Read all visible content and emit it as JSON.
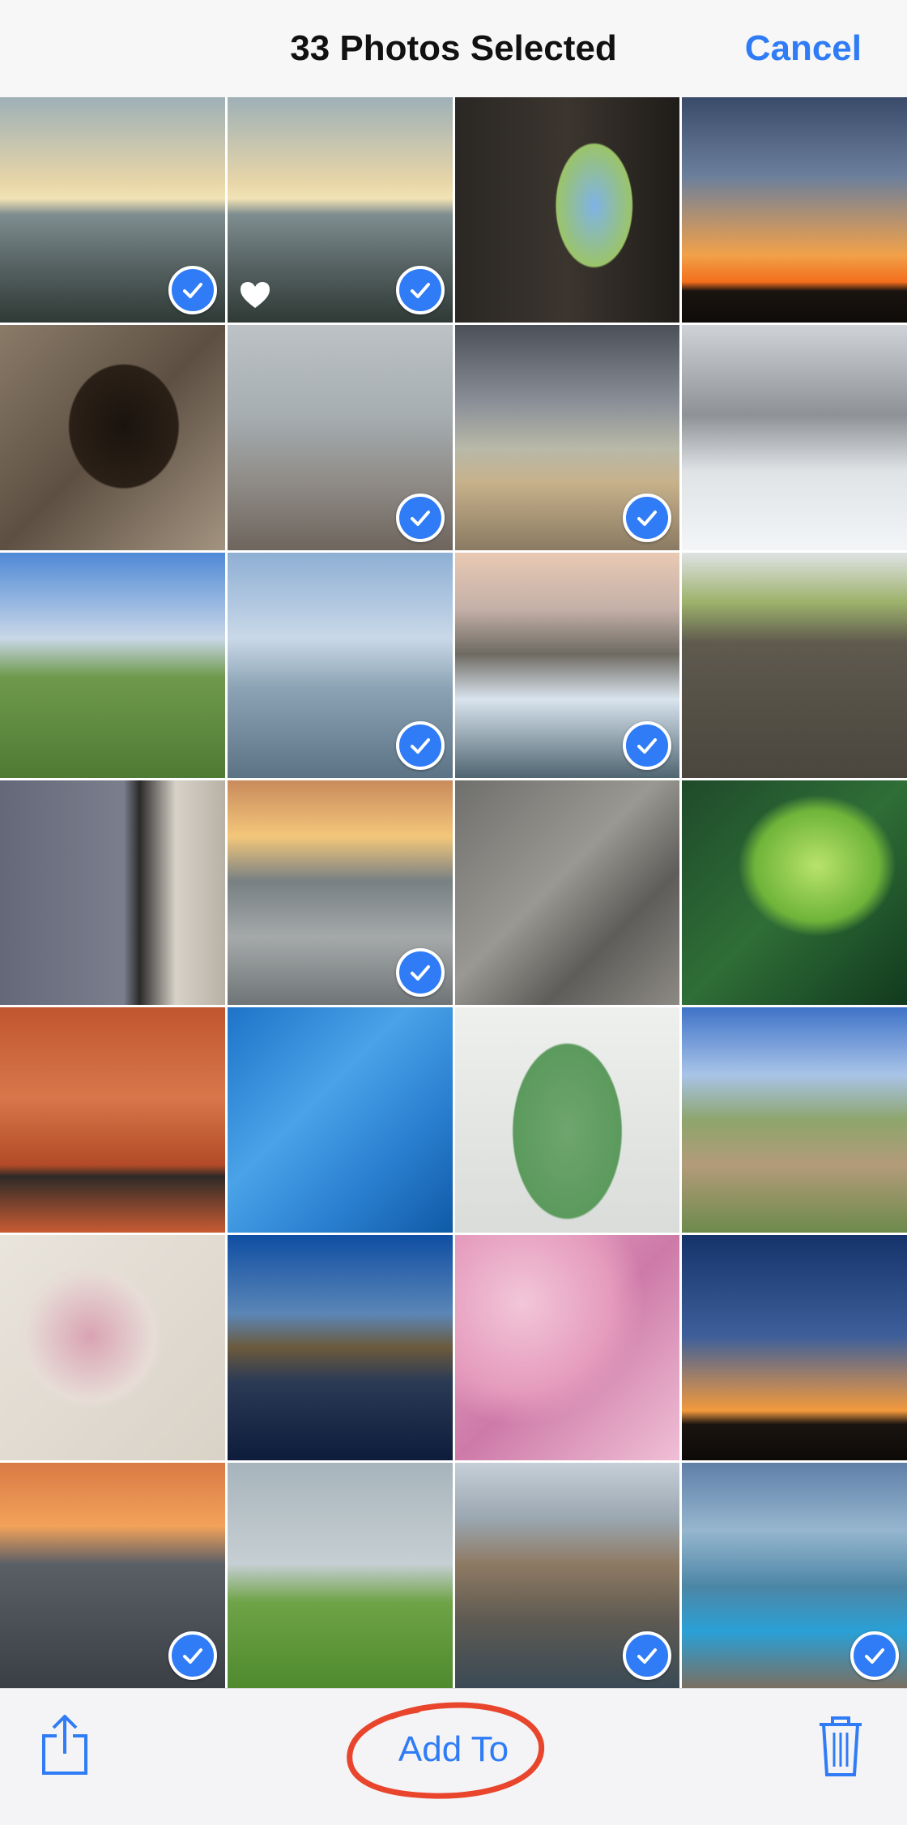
{
  "header": {
    "title": "33 Photos Selected",
    "cancel_label": "Cancel"
  },
  "toolbar": {
    "add_to_label": "Add To",
    "share_icon": "share-icon",
    "trash_icon": "trash-icon"
  },
  "colors": {
    "accent": "#2f7cf6",
    "annotation": "#e8452c"
  },
  "photos": [
    {
      "name": "photo-sea-sunrise",
      "selected": true,
      "favorite": false
    },
    {
      "name": "photo-sea-sunrise-copy",
      "selected": true,
      "favorite": true
    },
    {
      "name": "photo-arch-doorway",
      "selected": false,
      "favorite": false
    },
    {
      "name": "photo-sunset-silhouettes",
      "selected": false,
      "favorite": false
    },
    {
      "name": "photo-child-in-tree-trunk",
      "selected": false,
      "favorite": false
    },
    {
      "name": "photo-child-at-beach",
      "selected": true,
      "favorite": false
    },
    {
      "name": "photo-children-jumping",
      "selected": true,
      "favorite": false
    },
    {
      "name": "photo-snowy-avenue",
      "selected": false,
      "favorite": false
    },
    {
      "name": "photo-ponies-field",
      "selected": false,
      "favorite": false
    },
    {
      "name": "photo-dog-in-sea",
      "selected": true,
      "favorite": false
    },
    {
      "name": "photo-lighthouse-waves",
      "selected": true,
      "favorite": false
    },
    {
      "name": "photo-stone-wall",
      "selected": false,
      "favorite": false
    },
    {
      "name": "photo-dog-at-door",
      "selected": false,
      "favorite": false
    },
    {
      "name": "photo-sea-dusk",
      "selected": true,
      "favorite": false
    },
    {
      "name": "photo-hand-on-rock",
      "selected": false,
      "favorite": false
    },
    {
      "name": "photo-fern",
      "selected": false,
      "favorite": false
    },
    {
      "name": "photo-lavender-wall",
      "selected": false,
      "favorite": false
    },
    {
      "name": "photo-blue-peeling-paint",
      "selected": false,
      "favorite": false
    },
    {
      "name": "photo-green-door",
      "selected": false,
      "favorite": false
    },
    {
      "name": "photo-country-path",
      "selected": false,
      "favorite": false
    },
    {
      "name": "photo-dandelion-seedhead",
      "selected": false,
      "favorite": false
    },
    {
      "name": "photo-lake-reflection",
      "selected": false,
      "favorite": false
    },
    {
      "name": "photo-pink-flowers",
      "selected": false,
      "favorite": false
    },
    {
      "name": "photo-hill-silhouettes",
      "selected": false,
      "favorite": false
    },
    {
      "name": "photo-ocean-sunset",
      "selected": true,
      "favorite": false
    },
    {
      "name": "photo-rain-window",
      "selected": false,
      "favorite": false
    },
    {
      "name": "photo-harbour-boats",
      "selected": true,
      "favorite": false
    },
    {
      "name": "photo-child-on-cliff",
      "selected": true,
      "favorite": false
    }
  ]
}
